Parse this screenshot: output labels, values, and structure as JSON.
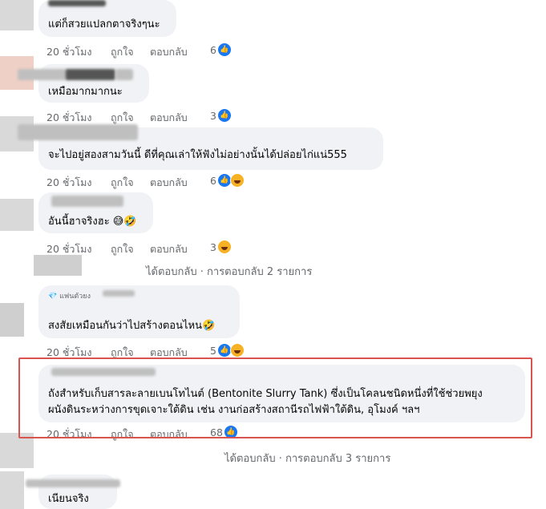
{
  "comments": [
    {
      "text": "แต่ก็สวยแปลกตาจริงๆนะ",
      "time": "20 ชั่วโมง",
      "like": "ถูกใจ",
      "reply": "ตอบกลับ",
      "reactions": "6"
    },
    {
      "text": "เหมือมากมากนะ",
      "time": "20 ชั่วโมง",
      "like": "ถูกใจ",
      "reply": "ตอบกลับ",
      "reactions": "3"
    },
    {
      "text": "จะไปอยู่สองสามวันนี้ ดีที่คุณเล่าให้ฟังไม่อย่างนั้นได้ปล่อยไก่แน่555",
      "time": "20 ชั่วโมง",
      "like": "ถูกใจ",
      "reply": "ตอบกลับ",
      "reactions": "6"
    },
    {
      "text": "อันนี้ฮาจริงฮะ 😅🤣",
      "time": "20 ชั่วโมง",
      "like": "ถูกใจ",
      "reply": "ตอบกลับ",
      "reactions": "3"
    },
    {
      "badge": "💎 แฟนตัวยง",
      "text": "สงสัยเหมือนกันว่าไปสร้างตอนไหน🤣",
      "time": "20 ชั่วโมง",
      "like": "ถูกใจ",
      "reply": "ตอบกลับ",
      "reactions": "5"
    },
    {
      "text1": "ถังสำหรับเก็บสารละลายเบนโทไนต์ (Bentonite Slurry Tank) ซึ่งเป็นโคลนชนิดหนึ่งที่ใช้ช่วยพยุง",
      "text2": "ผนังดินระหว่างการขุดเจาะใต้ดิน เช่น งานก่อสร้างสถานีรถไฟฟ้าใต้ดิน, อุโมงค์ ฯลฯ",
      "time": "20 ชั่วโมง",
      "like": "ถูกใจ",
      "reply": "ตอบกลับ",
      "reactions": "68"
    },
    {
      "text": "เนียนจริง"
    }
  ],
  "replies_link_1": "ได้ตอบกลับ · การตอบกลับ 2 รายการ",
  "replies_link_2": "ได้ตอบกลับ · การตอบกลับ 3 รายการ",
  "colors": {
    "bubble": "#f0f2f5",
    "meta": "#65676b",
    "like_blue": "#1877f2",
    "highlight": "#d9534f"
  }
}
